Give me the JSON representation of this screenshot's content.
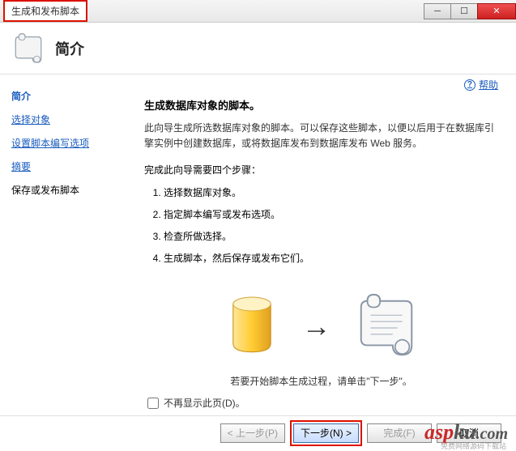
{
  "window": {
    "title": "生成和发布脚本"
  },
  "header": {
    "title": "简介"
  },
  "help": {
    "label": "帮助"
  },
  "sidebar": {
    "items": [
      {
        "label": "简介",
        "active": true
      },
      {
        "label": "选择对象"
      },
      {
        "label": "设置脚本编写选项"
      },
      {
        "label": "摘要"
      },
      {
        "label": "保存或发布脚本"
      }
    ]
  },
  "content": {
    "title": "生成数据库对象的脚本。",
    "desc": "此向导生成所选数据库对象的脚本。可以保存这些脚本，以便以后用于在数据库引擎实例中创建数据库，或将数据库发布到数据库发布 Web 服务。",
    "steps_intro": "完成此向导需要四个步骤：",
    "steps": [
      "选择数据库对象。",
      "指定脚本编写或发布选项。",
      "检查所做选择。",
      "生成脚本，然后保存或发布它们。"
    ],
    "start_text": "若要开始脚本生成过程，请单击\"下一步\"。",
    "checkbox_label": "不再显示此页(D)。"
  },
  "buttons": {
    "prev": "< 上一步(P)",
    "next": "下一步(N) >",
    "finish": "完成(F)",
    "cancel": "取消"
  },
  "watermark": {
    "part1": "asp",
    "part2": "ku",
    "sub": "免费网络源码下载站"
  }
}
